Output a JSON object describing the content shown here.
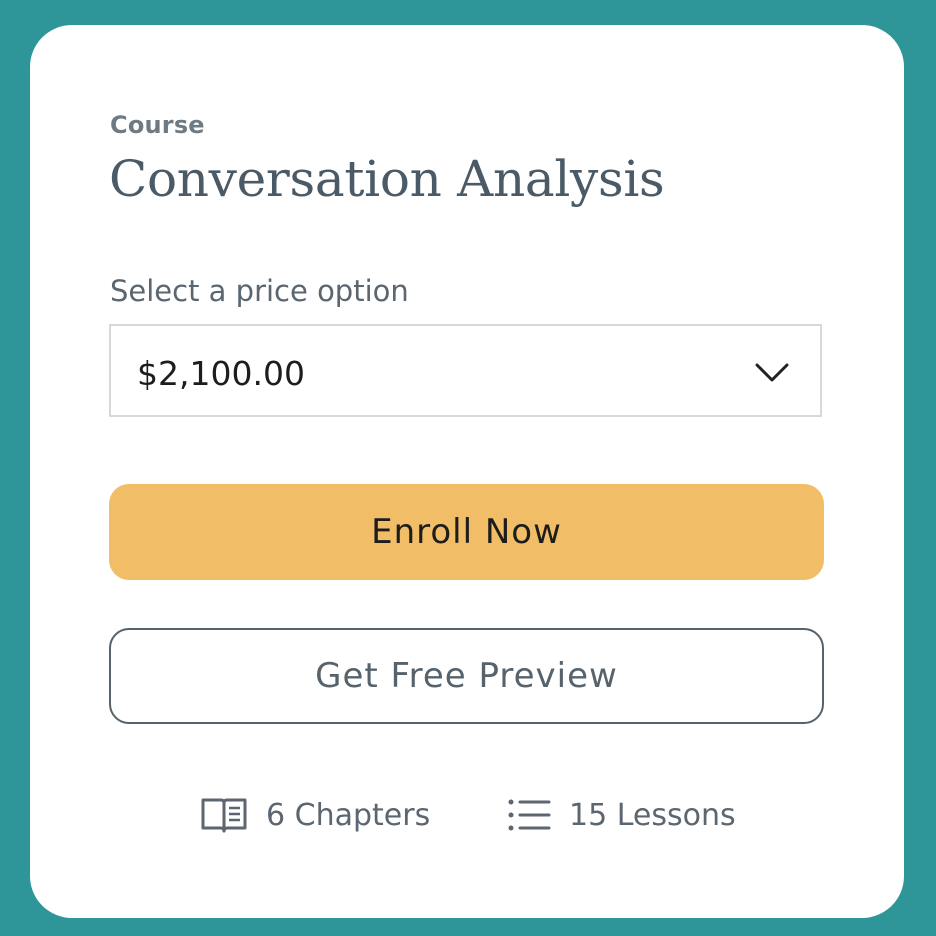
{
  "course": {
    "eyebrow": "Course",
    "title": "Conversation Analysis"
  },
  "price_select": {
    "label": "Select a price option",
    "selected_value": "$2,100.00",
    "icon": "chevron-down-icon"
  },
  "buttons": {
    "enroll_label": "Enroll Now",
    "preview_label": "Get Free Preview"
  },
  "meta": {
    "chapters": {
      "icon": "book-icon",
      "text": "6 Chapters"
    },
    "lessons": {
      "icon": "list-icon",
      "text": "15 Lessons"
    }
  },
  "colors": {
    "background": "#2e9598",
    "card": "#ffffff",
    "enroll_button": "#f1bd66",
    "text_muted": "#5b6670",
    "title": "#4a5a66"
  }
}
